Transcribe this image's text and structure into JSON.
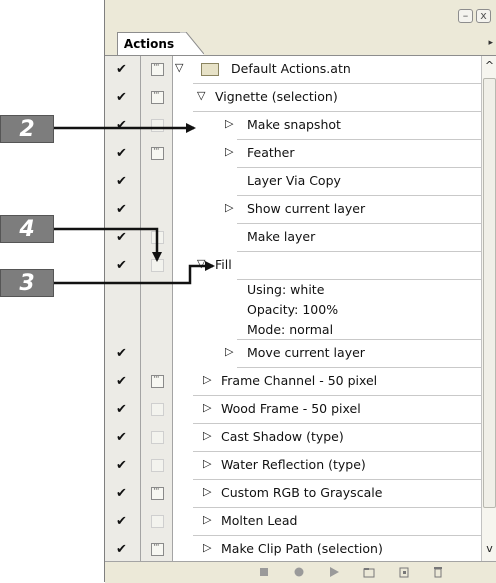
{
  "panel": {
    "tab_label": "Actions",
    "rows": [
      {
        "label": "Default Actions.atn",
        "checked": true,
        "dialog": "on",
        "triangle": "open",
        "folder": true
      },
      {
        "label": "Vignette (selection)",
        "checked": true,
        "dialog": "on",
        "triangle": "open"
      },
      {
        "label": "Make snapshot",
        "checked": true,
        "dialog": "off",
        "triangle": "closed"
      },
      {
        "label": "Feather",
        "checked": true,
        "dialog": "on",
        "triangle": "closed"
      },
      {
        "label": "Layer Via Copy",
        "checked": true,
        "dialog": "none",
        "triangle": "none"
      },
      {
        "label": "Show current layer",
        "checked": true,
        "dialog": "none",
        "triangle": "closed"
      },
      {
        "label": "Make layer",
        "checked": true,
        "dialog": "off",
        "triangle": "none"
      },
      {
        "label": "Fill",
        "checked": true,
        "dialog": "off",
        "triangle": "open"
      },
      {
        "label": "Using: white",
        "sub": true
      },
      {
        "label": "Opacity: 100%",
        "sub": true
      },
      {
        "label": "Mode: normal",
        "sub": true
      },
      {
        "label": "Move current layer",
        "checked": true,
        "dialog": "none",
        "triangle": "closed"
      },
      {
        "label": "Frame Channel - 50 pixel",
        "checked": true,
        "dialog": "on",
        "triangle": "closed"
      },
      {
        "label": "Wood Frame - 50 pixel",
        "checked": true,
        "dialog": "off",
        "triangle": "closed"
      },
      {
        "label": "Cast Shadow (type)",
        "checked": true,
        "dialog": "off",
        "triangle": "closed"
      },
      {
        "label": "Water Reflection (type)",
        "checked": true,
        "dialog": "off",
        "triangle": "closed"
      },
      {
        "label": "Custom RGB to Grayscale",
        "checked": true,
        "dialog": "on",
        "triangle": "closed"
      },
      {
        "label": "Molten Lead",
        "checked": true,
        "dialog": "off",
        "triangle": "closed"
      },
      {
        "label": "Make Clip Path (selection)",
        "checked": true,
        "dialog": "on",
        "triangle": "closed"
      }
    ]
  },
  "callouts": [
    "2",
    "4",
    "3"
  ],
  "glyphs": {
    "check": "✔",
    "tri_open": "▽",
    "tri_closed": "▷",
    "scroll_up": "^",
    "scroll_down": "v",
    "minimize": "–",
    "close": "x",
    "menu": "▸"
  },
  "colors": {
    "panel_bg": "#ece9d8",
    "callout_bg": "#7d7d7d",
    "arrow": "#111111"
  }
}
